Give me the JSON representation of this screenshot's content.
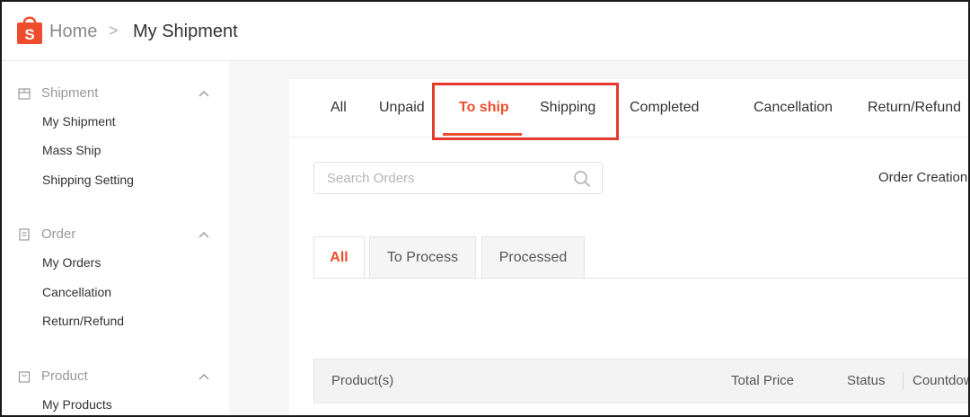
{
  "colors": {
    "brand": "#ee4d2d",
    "highlight": "#e63a2e"
  },
  "header": {
    "logo_icon": "shopee-bag-icon",
    "breadcrumb_home": "Home",
    "breadcrumb_separator": ">",
    "breadcrumb_current": "My Shipment"
  },
  "sidebar": {
    "sections": [
      {
        "title": "Shipment",
        "icon": "box-icon",
        "items": [
          "My Shipment",
          "Mass Ship",
          "Shipping Setting"
        ]
      },
      {
        "title": "Order",
        "icon": "clipboard-icon",
        "items": [
          "My Orders",
          "Cancellation",
          "Return/Refund"
        ]
      },
      {
        "title": "Product",
        "icon": "bag-icon",
        "items": [
          "My Products"
        ]
      }
    ]
  },
  "tabs": [
    "All",
    "Unpaid",
    "To ship",
    "Shipping",
    "Completed",
    "Cancellation",
    "Return/Refund"
  ],
  "active_tab": "To ship",
  "search": {
    "placeholder": "Search Orders",
    "value": ""
  },
  "order_creation_label": "Order Creation",
  "subtabs": [
    "All",
    "To Process",
    "Processed"
  ],
  "active_subtab": "All",
  "table_headers": [
    "Product(s)",
    "Total Price",
    "Status",
    "Countdow"
  ]
}
